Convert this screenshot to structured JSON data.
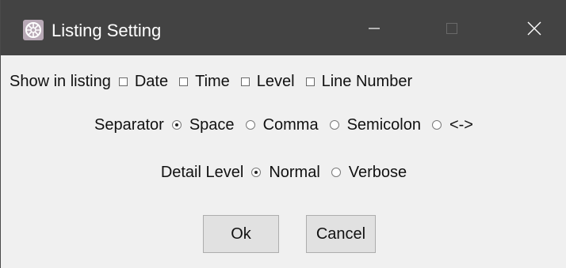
{
  "window": {
    "title": "Listing Setting",
    "icon": "app-logo-icon",
    "controls": {
      "minimize": "minimize-icon",
      "maximize": "maximize-icon",
      "close": "close-icon"
    }
  },
  "show_in_listing": {
    "label": "Show in listing",
    "options": [
      {
        "label": "Date",
        "checked": false
      },
      {
        "label": "Time",
        "checked": false
      },
      {
        "label": "Level",
        "checked": false
      },
      {
        "label": "Line Number",
        "checked": false
      }
    ]
  },
  "separator": {
    "label": "Separator",
    "options": [
      {
        "label": "Space",
        "selected": true
      },
      {
        "label": "Comma",
        "selected": false
      },
      {
        "label": "Semicolon",
        "selected": false
      },
      {
        "label": "<->",
        "selected": false
      }
    ]
  },
  "detail_level": {
    "label": "Detail Level",
    "options": [
      {
        "label": "Normal",
        "selected": true
      },
      {
        "label": "Verbose",
        "selected": false
      }
    ]
  },
  "buttons": {
    "ok": "Ok",
    "cancel": "Cancel"
  },
  "colors": {
    "titlebar": "#434343",
    "background": "#f0f0f0",
    "button": "#e1e1e1"
  }
}
